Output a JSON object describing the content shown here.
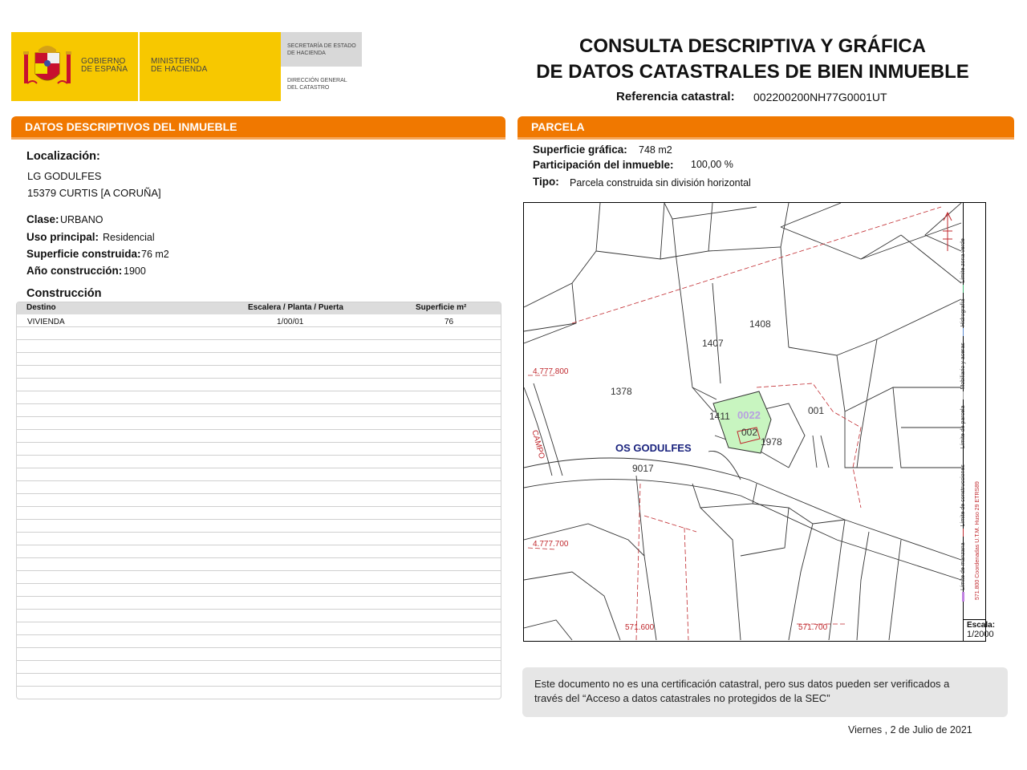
{
  "header": {
    "gov_line1": "GOBIERNO",
    "gov_line2": "DE ESPAÑA",
    "min_line1": "MINISTERIO",
    "min_line2": "DE HACIENDA",
    "sec_line1": "SECRETARÍA DE ESTADO",
    "sec_line2": "DE HACIENDA",
    "dir_line1": "DIRECCIÓN GENERAL",
    "dir_line2": "DEL CATASTRO",
    "title_line1": "CONSULTA DESCRIPTIVA Y GRÁFICA",
    "title_line2": "DE DATOS CATASTRALES DE BIEN INMUEBLE",
    "ref_label": "Referencia catastral:",
    "ref_value": "002200200NH77G0001UT"
  },
  "descriptive": {
    "section_title_prefix": "DATOS DESCRIPTIVOS DEL ",
    "section_title_bold": "INMUEBLE",
    "localizacion_label": "Localización:",
    "address_line1": "LG GODULFES",
    "address_line2": "15379 CURTIS [A CORUÑA]",
    "clase_label": "Clase:",
    "clase_value": "URBANO",
    "uso_label": "Uso principal:",
    "uso_value": "Residencial",
    "superficie_label": "Superficie construida:",
    "superficie_value": "76 m2",
    "anio_label": "Año construcción:",
    "anio_value": "1900",
    "construccion_label": "Construcción",
    "table": {
      "headers": [
        "Destino",
        "Escalera / Planta / Puerta",
        "Superficie m²"
      ],
      "rows": [
        [
          "VIVIENDA",
          "1/00/01",
          "76"
        ]
      ]
    }
  },
  "parcela": {
    "section_title": "PARCELA",
    "sup_label": "Superficie gráfica:",
    "sup_value": "748 m2",
    "part_label": "Participación del inmueble:",
    "part_value": "100,00 %",
    "tipo_label": "Tipo:",
    "tipo_value": "Parcela construida sin división horizontal"
  },
  "map": {
    "parcel_labels": [
      "1408",
      "1407",
      "1378",
      "1411",
      "0022",
      "002",
      "1978",
      "001",
      "9017"
    ],
    "place_name": "OS GODULFES",
    "street_label": "CAMPO",
    "coord_y1": "4.777.800",
    "coord_y2": "4.777.700",
    "coord_x1": "571.600",
    "coord_x2": "571.700",
    "legend_items": [
      "Límite de manzana",
      "Límite de construcciones",
      "Límite de parcela",
      "Mobiliario y aceras",
      "Hidrografía",
      "Límite zona verde"
    ],
    "coord_note": "571.800 Coordenadas U.T.M. Huso 29 ETRS89",
    "scale_label": "Escala:",
    "scale_value": "1/2000"
  },
  "footer": {
    "note_line1": "Este documento no es una certificación catastral, pero sus datos pueden ser verificados a",
    "note_line2": "través del “Acceso a datos catastrales no protegidos de la SEC”",
    "date": "Viernes , 2 de Julio de 2021"
  },
  "colors": {
    "accent_orange": "#f07800",
    "logo_yellow": "#f7c800",
    "parcel_fill": "#c8f5c0",
    "coord_red": "#c0282d"
  }
}
